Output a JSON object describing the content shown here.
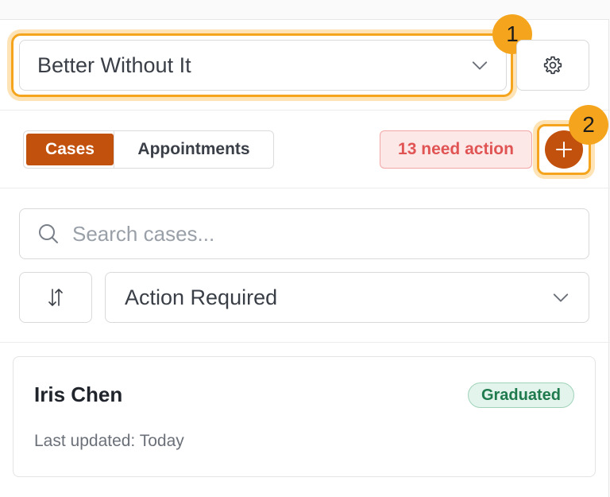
{
  "workspace": {
    "selected": "Better Without It"
  },
  "steps": {
    "one": "1",
    "two": "2"
  },
  "tabs": [
    {
      "label": "Cases",
      "active": true
    },
    {
      "label": "Appointments",
      "active": false
    }
  ],
  "need_action": {
    "label": "13 need action"
  },
  "search": {
    "placeholder": "Search cases..."
  },
  "filter": {
    "selected": "Action Required"
  },
  "cases": [
    {
      "name": "Iris Chen",
      "status": "Graduated",
      "updated": "Last updated: Today"
    }
  ],
  "icons": {
    "settings": "gear-icon",
    "add": "plus-icon",
    "search": "search-icon",
    "sort": "sort-arrows-icon",
    "dropdown": "chevron-down-icon"
  },
  "colors": {
    "accent": "#c2510d",
    "highlight": "#f5a51d",
    "alert_bg": "#fde8e8",
    "alert_text": "#e05454",
    "success_bg": "#e3f4ec",
    "success_text": "#1f7a4d"
  }
}
